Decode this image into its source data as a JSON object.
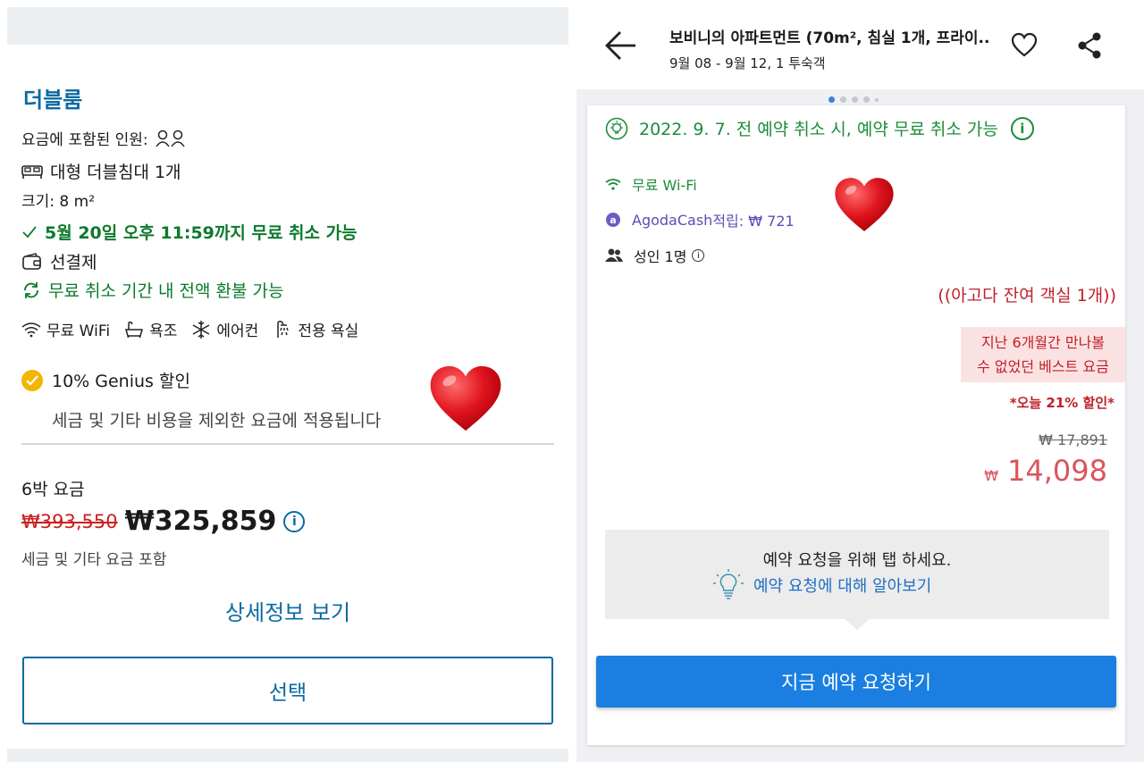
{
  "left": {
    "room_title": "더블룸",
    "guests_label": "요금에 포함된 인원:",
    "bed": "대형 더블침대 1개",
    "size": "크기: 8 m²",
    "free_cancel": "5월 20일 오후 11:59까지 무료 취소 가능",
    "prepay": "선결제",
    "refund": "무료 취소 기간 내 전액 환불 가능",
    "amenities": {
      "wifi": "무료 WiFi",
      "bath": "욕조",
      "ac": "에어컨",
      "shower": "전용 욕실"
    },
    "genius": "10% Genius 할인",
    "genius_note": "세금 및 기타 비용을 제외한 요금에 적용됩니다",
    "nights_label": "6박 요금",
    "price_old": "₩393,550",
    "price_new": "₩325,859",
    "tax_note": "세금 및 기타 요금 포함",
    "detail_link": "상세정보 보기",
    "select_button": "선택"
  },
  "right": {
    "title": "보비니의 아파트먼트 (70m², 침실 1개, 프라이...",
    "subtitle": "9월 08 - 9월 12, 1 투숙객",
    "cancel_policy": "2022. 9. 7. 전 예약 취소 시, 예약 무료 취소 가능",
    "wifi": "무료 Wi-Fi",
    "agoda_cash_name": "AgodaCash",
    "agoda_cash_rest": " 적립: ₩ 721",
    "adults": "성인 1명",
    "rooms_left": "((아고다 잔여 객실 1개))",
    "best_rate_line1": "지난 6개월간 만나볼",
    "best_rate_line2": "수 없었던 베스트 요금",
    "discount": "*오늘 21% 할인*",
    "price_old": "₩ 17,891",
    "currency": "₩",
    "price_new": "14,098",
    "tooltip_text": "예약 요청을 위해 탭 하세요.",
    "tooltip_link": "예약 요청에 대해 알아보기",
    "book_button": "지금 예약 요청하기"
  },
  "colors": {
    "booking_blue": "#0a6aa1",
    "green": "#0c7a2c",
    "agoda_green": "#1e8c3a",
    "agoda_red": "#c0202a",
    "agoda_blue_button": "#1a7fe0",
    "heart": "#e0141e"
  },
  "icons": [
    "people-icon",
    "bed-icon",
    "check-icon",
    "wallet-icon",
    "refresh-icon",
    "wifi-icon",
    "bathtub-icon",
    "snowflake-icon",
    "shower-icon",
    "genius-check-icon",
    "info-icon",
    "back-arrow-icon",
    "favorite-heart-icon",
    "share-icon",
    "eco-bulb-icon",
    "agoda-cash-icon",
    "adults-icon",
    "lightbulb-icon",
    "heart-emoji-icon"
  ]
}
